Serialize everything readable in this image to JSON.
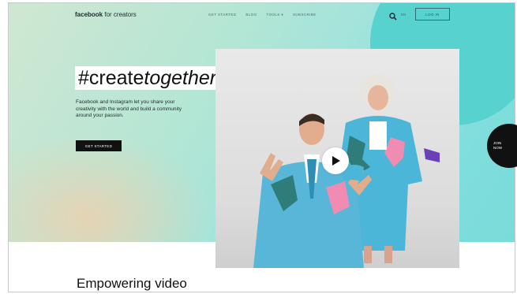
{
  "header": {
    "logo_bold": "facebook",
    "logo_rest": " for creators",
    "nav": [
      "GET STARTED",
      "BLOG",
      "TOOLS ▾",
      "SUBSCRIBE"
    ],
    "lang": "EN",
    "login": "LOG IN"
  },
  "hero": {
    "headline_prefix": "#create",
    "headline_italic": "together",
    "description": "Facebook and Instagram let you share your creativity with the world and build a community around your passion.",
    "cta": "GET STARTED"
  },
  "join": {
    "line1": "JOIN",
    "line2": "NOW"
  },
  "section": {
    "title": "Empowering video"
  },
  "icons": {
    "search": "search-icon",
    "play": "play-icon"
  },
  "colors": {
    "hero_teal": "#57d2cf",
    "cta_bg": "#111111",
    "accent": "#2d6c73"
  }
}
